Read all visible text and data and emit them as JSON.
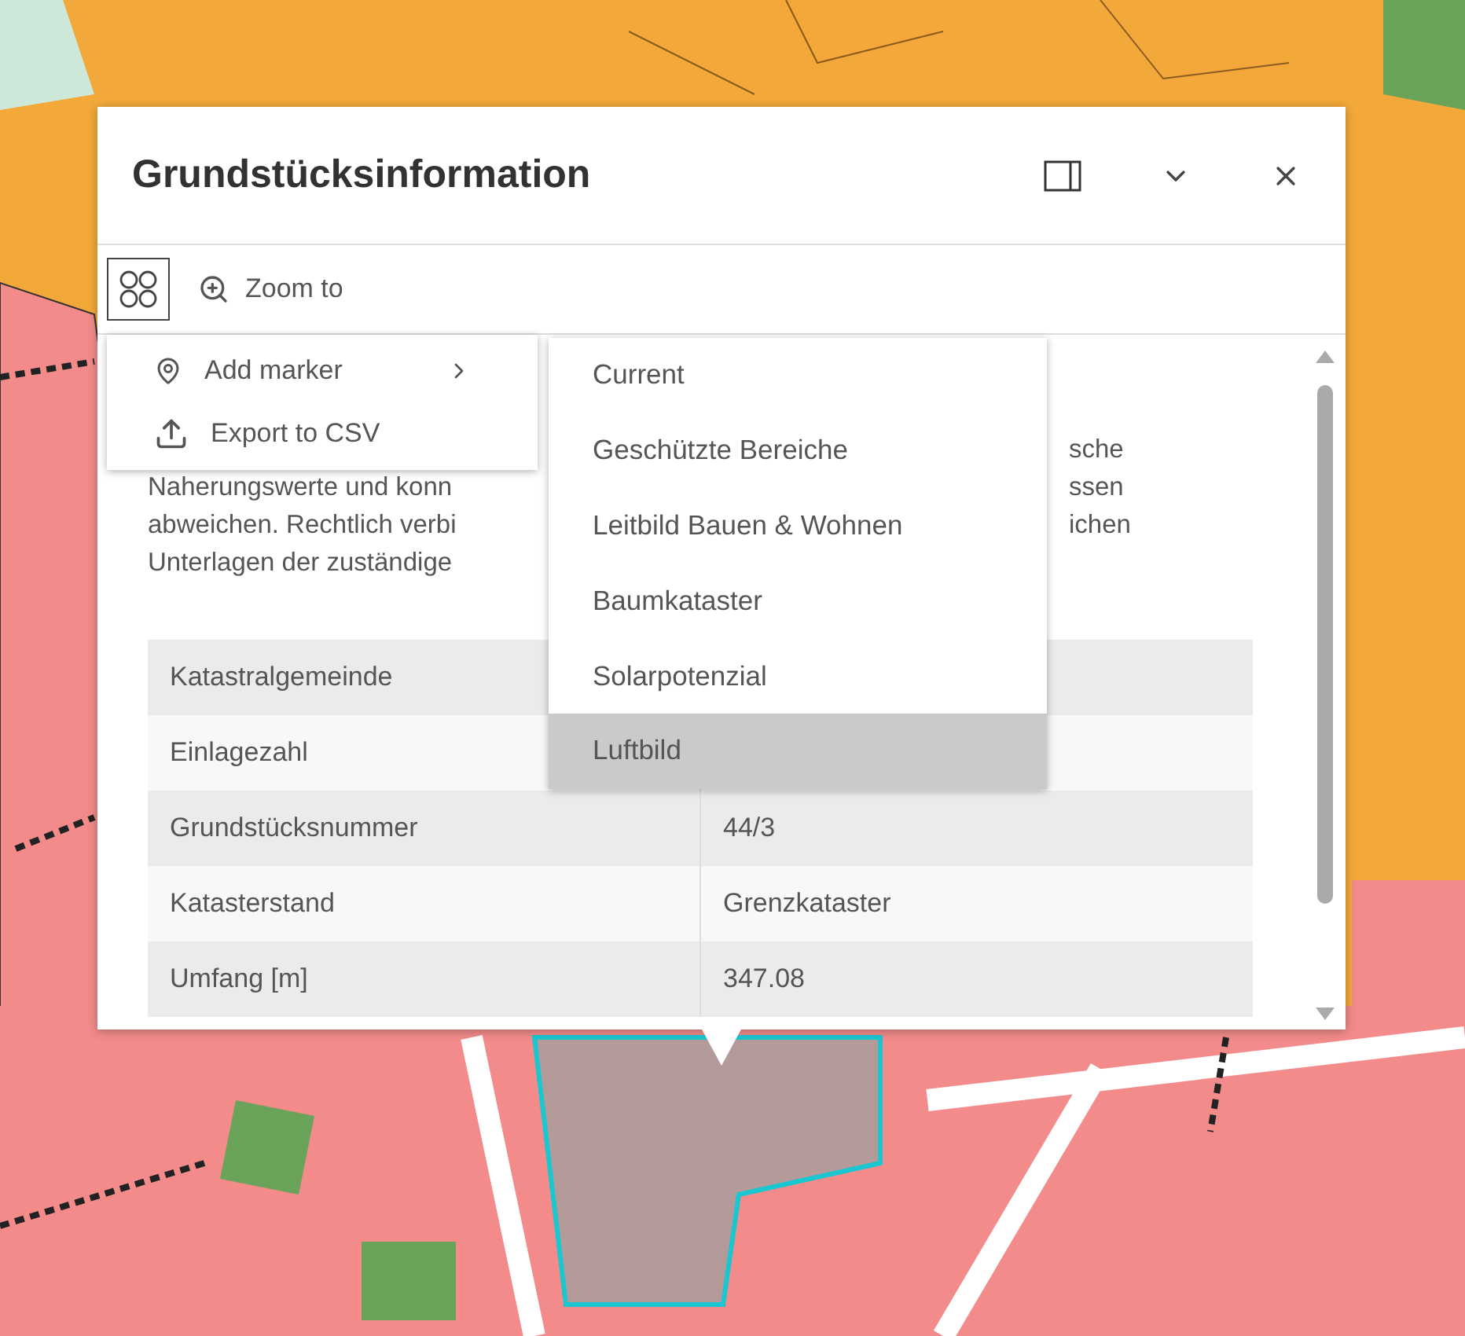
{
  "popup": {
    "title": "Grundstücksinformation",
    "actions_button": {
      "expanded": true
    },
    "toolbar": [
      {
        "label": "Zoom to"
      }
    ],
    "description": [
      {
        "right": "sche"
      },
      {
        "left": "Naherungswerte und konn",
        "right": "ssen"
      },
      {
        "left": "abweichen. Rechtlich verbi",
        "right": "ichen"
      },
      {
        "left": "Unterlagen der zuständige"
      }
    ],
    "table": {
      "rows": [
        {
          "label": "Katastralgemeinde"
        },
        {
          "label": "Einlagezahl"
        },
        {
          "label": "Grundstücksnummer",
          "value": "44/3"
        },
        {
          "label": "Katasterstand",
          "value": "Grenzkataster"
        },
        {
          "label": "Umfang [m]",
          "value": "347.08"
        }
      ]
    }
  },
  "actions_menu": {
    "items": [
      {
        "kind": "submenu",
        "label": "Add marker"
      },
      {
        "kind": "action",
        "label": "Export to CSV"
      }
    ]
  },
  "submenu": {
    "items": [
      {
        "label": "Current",
        "selected": false
      },
      {
        "label": "Geschützte Bereiche",
        "selected": false
      },
      {
        "label": "Leitbild Bauen & Wohnen",
        "selected": false
      },
      {
        "label": "Baumkataster",
        "selected": false
      },
      {
        "label": "Solarpotenzial",
        "selected": false
      },
      {
        "label": "Luftbild",
        "selected": true
      }
    ]
  }
}
